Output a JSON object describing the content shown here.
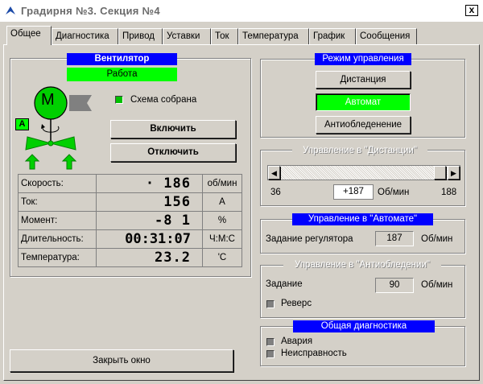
{
  "window": {
    "title": "Градирня №3. Секция №4",
    "close_label": "x"
  },
  "tabs": [
    "Общее",
    "Диагностика",
    "Привод",
    "Уставки",
    "Ток",
    "Температура",
    "График",
    "Сообщения"
  ],
  "active_tab": 0,
  "fan": {
    "header": "Вентилятор",
    "status": "Работа",
    "motor_letter": "M",
    "mode_badge": "A",
    "circuit_label": "Схема собрана",
    "on_button": "Включить",
    "off_button": "Отключить"
  },
  "params": [
    {
      "label": "Скорость:",
      "value": "· 186",
      "unit": "об/мин"
    },
    {
      "label": "Ток:",
      "value": "156",
      "unit": "А"
    },
    {
      "label": "Момент:",
      "value": "-8 1",
      "unit": "%"
    },
    {
      "label": "Длительность:",
      "value": "00:31:07",
      "unit": "Ч:М:С"
    },
    {
      "label": "Температура:",
      "value": "23.2",
      "unit": "'С"
    }
  ],
  "close_window": "Закрыть окно",
  "control_mode": {
    "header": "Режим управления",
    "remote": "Дистанция",
    "auto": "Автомат",
    "antiice": "Антиобледенение"
  },
  "remote": {
    "header": "Управление в \"Дистанции\"",
    "min": "36",
    "max": "188",
    "value": "+187",
    "unit": "Об/мин",
    "slider_fraction": 0.99
  },
  "auto": {
    "header": "Управление в \"Автомате\"",
    "label": "Задание регулятора",
    "value": "187",
    "unit": "Об/мин"
  },
  "antiice": {
    "header": "Управление в \"Антиобледении\"",
    "label": "Задание",
    "value": "90",
    "unit": "Об/мин",
    "reverse": "Реверс"
  },
  "diagnostics": {
    "header": "Общая диагностика",
    "alarm": "Авария",
    "fault": "Неисправность"
  },
  "colors": {
    "blue_header": "#0000ff",
    "green_active": "#00ff00",
    "led_green": "#00c000"
  }
}
